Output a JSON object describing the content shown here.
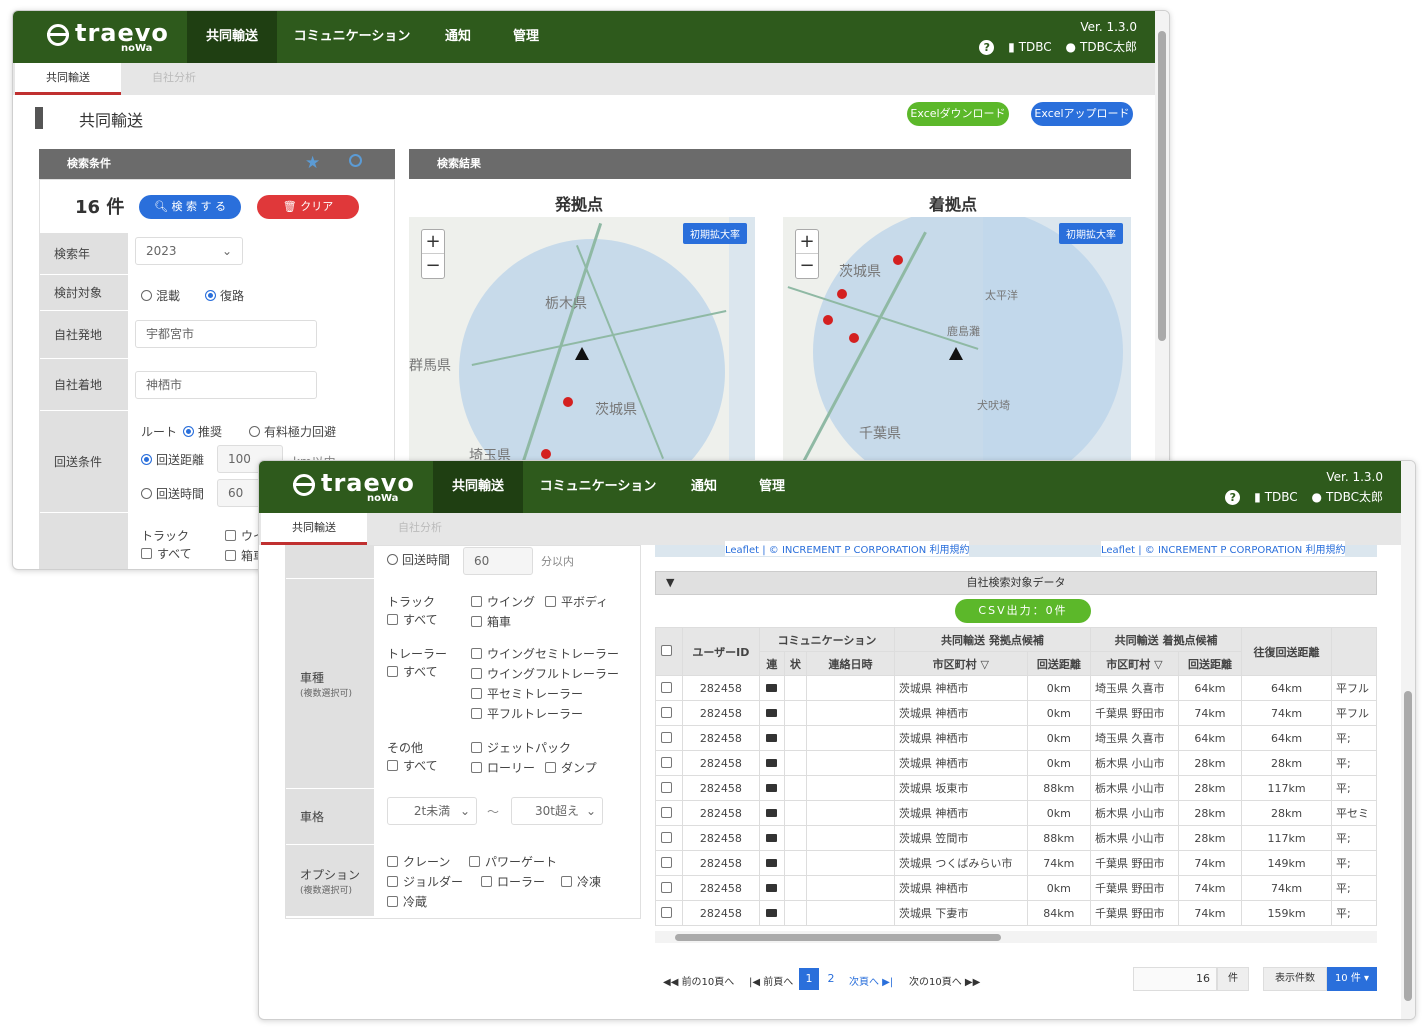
{
  "app": {
    "logo": "traevo",
    "logo_sub": "noWa",
    "version": "Ver. 1.3.0",
    "help_icon": "question-circle-icon",
    "org": "TDBC",
    "user": "TDBC太郎",
    "nav": [
      "共同輸送",
      "コミュニケーション",
      "通知",
      "管理"
    ],
    "tabs": [
      "共同輸送",
      "自社分析"
    ]
  },
  "page": {
    "title": "共同輸送",
    "excel_download": "Excelダウンロード",
    "excel_upload": "Excelアップロード"
  },
  "search": {
    "header": "検索条件",
    "count": "16 件",
    "search_btn": "検 索 す る",
    "clear_btn": "クリア",
    "year_label": "検索年",
    "year": "2023",
    "target_label": "検討対象",
    "target_options": [
      "混載",
      "復路"
    ],
    "origin_label": "自社発地",
    "origin": "宇都宮市",
    "dest_label": "自社着地",
    "dest": "神栖市",
    "return_label": "回送条件",
    "route_label": "ルート",
    "route_options": [
      "推奨",
      "有料極力回避"
    ],
    "distance_label": "回送距離",
    "distance": "100",
    "distance_unit": "km以内",
    "time_label": "回送時間",
    "time": "60",
    "time_unit": "分以内",
    "vehicle_label": "車種",
    "vehicle_sub": "(複数選択可)",
    "truck_label": "トラック",
    "all": "すべて",
    "truck_options": [
      "ウイング",
      "平ボディ",
      "箱車"
    ],
    "trailer_label": "トレーラー",
    "trailer_options": [
      "ウイングセミトレーラー",
      "ウイングフルトレーラー",
      "平セミトレーラー",
      "平フルトレーラー"
    ],
    "other_label": "その他",
    "other_options": [
      "ジェットパック",
      "ローリー",
      "ダンプ"
    ],
    "size_label": "車格",
    "size_from": "2t未満",
    "size_tilde": "〜",
    "size_to": "30t超え",
    "option_label": "オプション",
    "option_sub": "(複数選択可)",
    "option_items": [
      "クレーン",
      "パワーゲート",
      "ジョルダー",
      "ローラー",
      "冷凍",
      "冷蔵"
    ]
  },
  "results": {
    "header": "検索結果",
    "origin_title": "発拠点",
    "dest_title": "着拠点",
    "reset_zoom": "初期拡大率",
    "zoom_in": "+",
    "zoom_out": "−",
    "map1_labels": [
      "栃木県",
      "群馬県",
      "茨城県",
      "埼玉県"
    ],
    "map2_labels": [
      "茨城県",
      "太平洋",
      "鹿島灘",
      "犬吠埼",
      "千葉県"
    ],
    "attribution": "Leaflet | © INCREMENT P CORPORATION 利用規約",
    "own_data": "自社検索対象データ",
    "csv_btn": "CSV出力：0件"
  },
  "table": {
    "col_user": "ユーザーID",
    "col_comm": "コミュニケーション",
    "col_comm_sub": [
      "連",
      "状",
      "連絡日時"
    ],
    "col_origin": "共同輸送 発拠点候補",
    "col_dest": "共同輸送 着拠点候補",
    "col_city": "市区町村",
    "col_dist": "回送距離",
    "col_total": "往復回送距離",
    "rows": [
      {
        "id": "282458",
        "o_city": "茨城県 神栖市",
        "o_dist": "0km",
        "d_city": "埼玉県 久喜市",
        "d_dist": "64km",
        "total": "64km",
        "type": "平フル"
      },
      {
        "id": "282458",
        "o_city": "茨城県 神栖市",
        "o_dist": "0km",
        "d_city": "千葉県 野田市",
        "d_dist": "74km",
        "total": "74km",
        "type": "平フル"
      },
      {
        "id": "282458",
        "o_city": "茨城県 神栖市",
        "o_dist": "0km",
        "d_city": "埼玉県 久喜市",
        "d_dist": "64km",
        "total": "64km",
        "type": "平;"
      },
      {
        "id": "282458",
        "o_city": "茨城県 神栖市",
        "o_dist": "0km",
        "d_city": "栃木県 小山市",
        "d_dist": "28km",
        "total": "28km",
        "type": "平;"
      },
      {
        "id": "282458",
        "o_city": "茨城県 坂東市",
        "o_dist": "88km",
        "d_city": "栃木県 小山市",
        "d_dist": "28km",
        "total": "117km",
        "type": "平;"
      },
      {
        "id": "282458",
        "o_city": "茨城県 神栖市",
        "o_dist": "0km",
        "d_city": "栃木県 小山市",
        "d_dist": "28km",
        "total": "28km",
        "type": "平セミ"
      },
      {
        "id": "282458",
        "o_city": "茨城県 笠間市",
        "o_dist": "88km",
        "d_city": "栃木県 小山市",
        "d_dist": "28km",
        "total": "117km",
        "type": "平;"
      },
      {
        "id": "282458",
        "o_city": "茨城県 つくばみらい市",
        "o_dist": "74km",
        "d_city": "千葉県 野田市",
        "d_dist": "74km",
        "total": "149km",
        "type": "平;"
      },
      {
        "id": "282458",
        "o_city": "茨城県 神栖市",
        "o_dist": "0km",
        "d_city": "千葉県 野田市",
        "d_dist": "74km",
        "total": "74km",
        "type": "平;"
      },
      {
        "id": "282458",
        "o_city": "茨城県 下妻市",
        "o_dist": "84km",
        "d_city": "千葉県 野田市",
        "d_dist": "74km",
        "total": "159km",
        "type": "平;"
      }
    ]
  },
  "pager": {
    "prev10": "前の10頁へ",
    "prev": "前頁へ",
    "pages": [
      "1",
      "2"
    ],
    "next": "次頁へ",
    "next10": "次の10頁へ",
    "total": "16",
    "unit": "件",
    "per_page_label": "表示件数",
    "per_page": "10 件"
  },
  "colors": {
    "brand": "#2e5a1c",
    "accent": "#2a6fdb",
    "danger": "#e0383a",
    "green_btn": "#5cb82a"
  }
}
